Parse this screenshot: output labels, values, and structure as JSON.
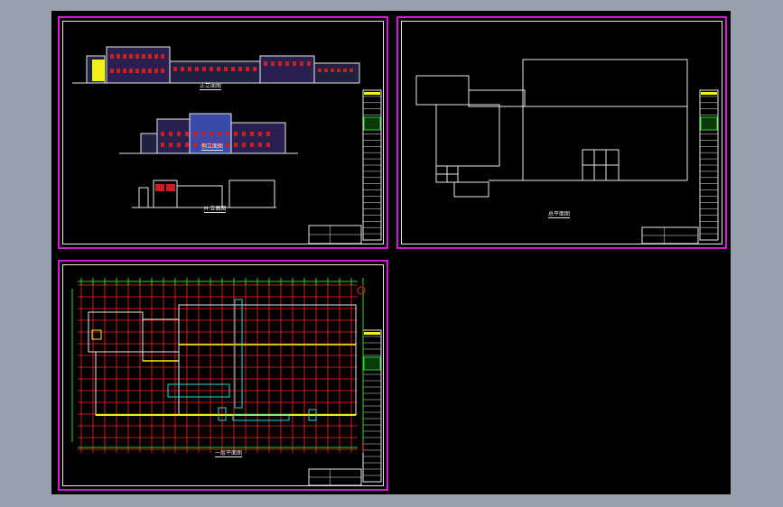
{
  "app": {
    "background_color": "#96a1ad",
    "model_space_color": "#000000"
  },
  "colors": {
    "sheet_border": "#d817d8",
    "line_white": "#e8e8e8",
    "grid_red": "#ff2020",
    "axis_green": "#22d822",
    "wall_yellow": "#f2f21a",
    "room_cyan": "#2ad8d8",
    "roof_red": "#c82020",
    "facade_blue": "#3a4aa8"
  },
  "sheets": {
    "elevations": {
      "label_top": "正立面图",
      "label_mid": "侧立面图",
      "label_bottom": "H 立面图"
    },
    "site_plan": {
      "label": "总平面图"
    },
    "floor_plan": {
      "label": "一层平面图"
    }
  }
}
